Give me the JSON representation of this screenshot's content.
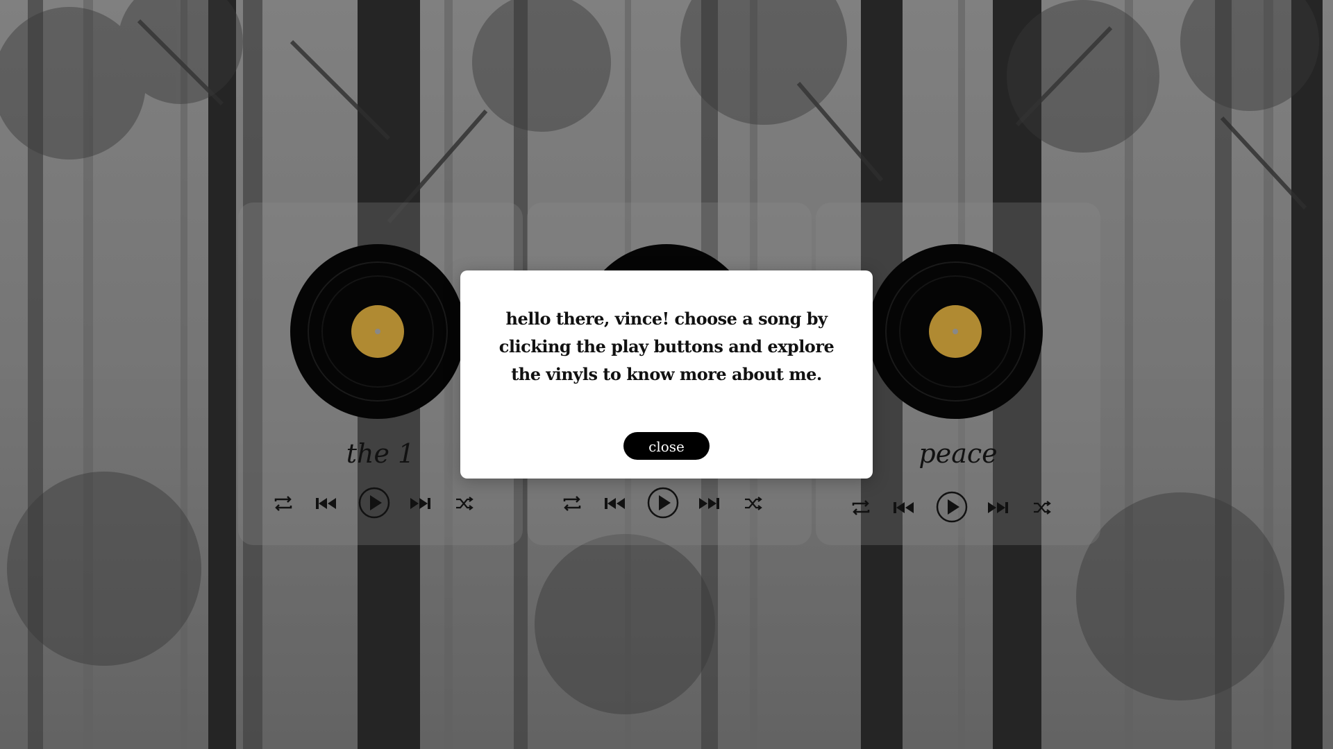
{
  "songs": [
    {
      "title": "the 1"
    },
    {
      "title": ""
    },
    {
      "title": "peace"
    }
  ],
  "modal": {
    "message": "hello there, vince! choose a song by clicking the play buttons and explore the vinyls to know more about me.",
    "close_label": "close"
  },
  "colors": {
    "label_gold": "#b08a32",
    "vinyl_black": "#050505",
    "modal_bg": "#ffffff",
    "button_bg": "#000000"
  },
  "controls": [
    "repeat-icon",
    "previous-icon",
    "play-icon",
    "next-icon",
    "shuffle-icon"
  ]
}
